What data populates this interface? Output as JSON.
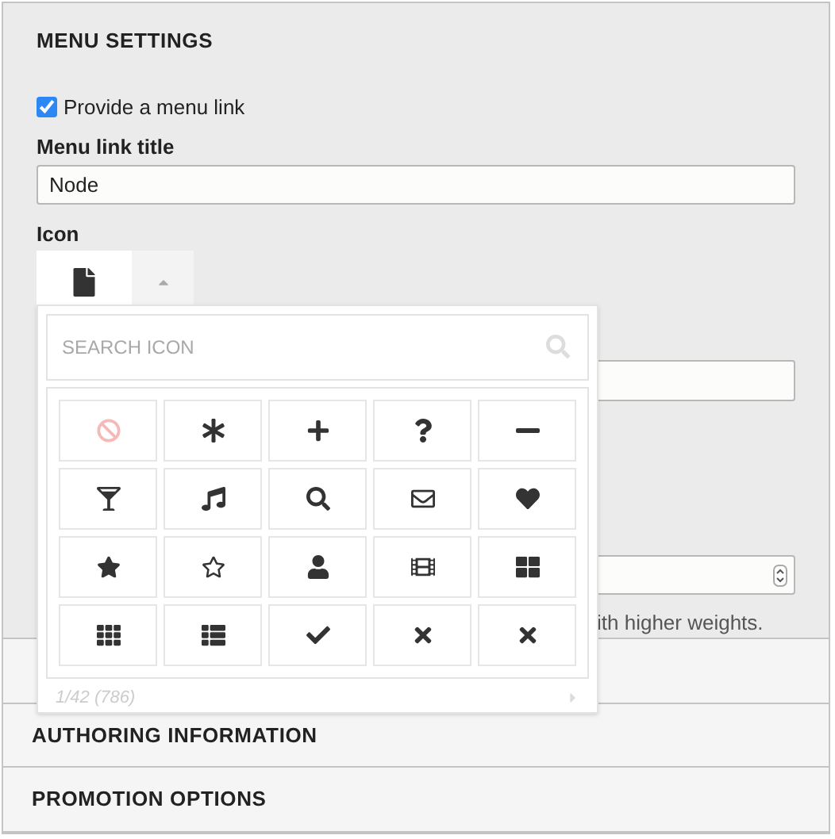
{
  "menu_settings": {
    "title": "MENU SETTINGS",
    "provide_link": {
      "label": "Provide a menu link",
      "checked": true
    },
    "link_title": {
      "label": "Menu link title",
      "value": "Node"
    },
    "icon": {
      "label": "Icon",
      "expanded": true
    },
    "weight_description": "ith higher weights."
  },
  "icon_picker": {
    "search": {
      "placeholder": "SEARCH ICON"
    },
    "icons": [
      {
        "kind": "none"
      },
      {
        "kind": "asterisk"
      },
      {
        "kind": "plus"
      },
      {
        "kind": "question"
      },
      {
        "kind": "minus"
      },
      {
        "kind": "glass"
      },
      {
        "kind": "music"
      },
      {
        "kind": "search"
      },
      {
        "kind": "envelope"
      },
      {
        "kind": "heart"
      },
      {
        "kind": "star"
      },
      {
        "kind": "star-outline"
      },
      {
        "kind": "user"
      },
      {
        "kind": "film"
      },
      {
        "kind": "grid-large"
      },
      {
        "kind": "grid"
      },
      {
        "kind": "list"
      },
      {
        "kind": "check"
      },
      {
        "kind": "times"
      },
      {
        "kind": "times"
      }
    ],
    "pager": "1/42 (786)"
  },
  "sections": [
    {
      "title": "AUTHORING INFORMATION"
    },
    {
      "title": "PROMOTION OPTIONS"
    }
  ]
}
